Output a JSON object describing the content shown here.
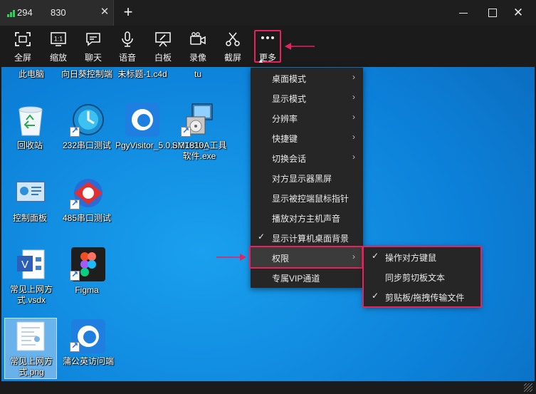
{
  "tab": {
    "connection_id": "294       830",
    "close": "✕"
  },
  "add_tab": "+",
  "window": {
    "minimize": "",
    "maximize": "",
    "close": "✕"
  },
  "toolbar": [
    {
      "icon": "fullscreen-icon",
      "label": "全屏"
    },
    {
      "icon": "zoom-1to1-icon",
      "label": "缩放"
    },
    {
      "icon": "chat-icon",
      "label": "聊天"
    },
    {
      "icon": "microphone-icon",
      "label": "语音"
    },
    {
      "icon": "whiteboard-icon",
      "label": "白板"
    },
    {
      "icon": "video-record-icon",
      "label": "录像"
    },
    {
      "icon": "scissors-icon",
      "label": "截屏"
    },
    {
      "icon": "more-dots-icon",
      "label": "更多"
    }
  ],
  "desktop_icons": [
    {
      "label": "此电脑"
    },
    {
      "label": "向日葵控制端"
    },
    {
      "label": "未标题-1.c4d"
    },
    {
      "label": "tu"
    },
    {
      "label": "回收站"
    },
    {
      "label": "232串口测试"
    },
    {
      "label": "PgyVisitor_5.0.0.37938_..."
    },
    {
      "label": "SM1810A工具软件.exe"
    },
    {
      "label": "控制面板"
    },
    {
      "label": "485串口测试"
    },
    {
      "label": "常见上网方式.vsdx"
    },
    {
      "label": "Figma"
    },
    {
      "label": "常见上网方式.png"
    },
    {
      "label": "蒲公英访问端"
    }
  ],
  "menu": [
    {
      "label": "桌面模式",
      "submenu": true,
      "checked": false
    },
    {
      "label": "显示模式",
      "submenu": true,
      "checked": false
    },
    {
      "label": "分辨率",
      "submenu": true,
      "checked": false
    },
    {
      "label": "快捷键",
      "submenu": true,
      "checked": false
    },
    {
      "label": "切换会话",
      "submenu": true,
      "checked": false
    },
    {
      "label": "对方显示器黑屏",
      "submenu": false,
      "checked": false
    },
    {
      "label": "显示被控端鼠标指针",
      "submenu": false,
      "checked": false
    },
    {
      "label": "播放对方主机声音",
      "submenu": false,
      "checked": false
    },
    {
      "label": "显示计算机桌面背景",
      "submenu": false,
      "checked": true
    },
    {
      "label": "权限",
      "submenu": true,
      "checked": false
    },
    {
      "label": "专属VIP通道",
      "submenu": false,
      "checked": false
    }
  ],
  "submenu": [
    {
      "label": "操作对方键鼠",
      "checked": true
    },
    {
      "label": "同步剪切板文本",
      "checked": false
    },
    {
      "label": "剪贴板/拖拽传输文件",
      "checked": true
    }
  ],
  "colors": {
    "accent_highlight": "#e8215f",
    "signal": "#30d158",
    "menu_bg": "#262626"
  }
}
